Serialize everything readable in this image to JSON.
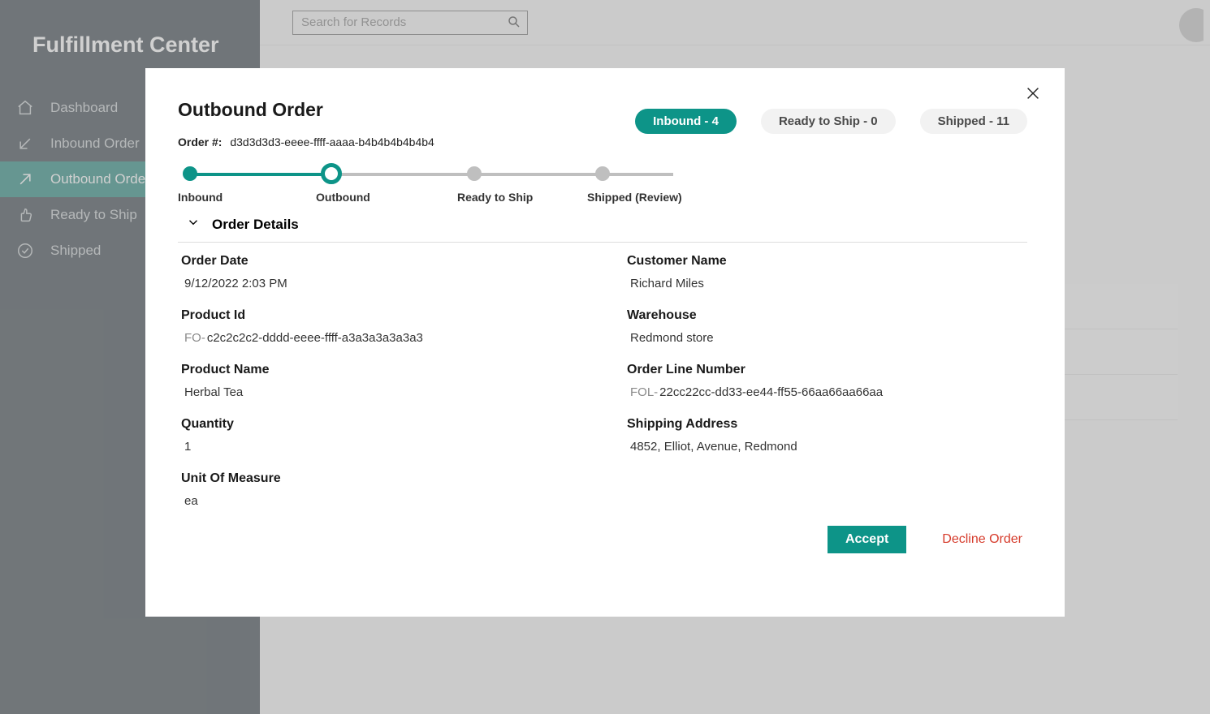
{
  "app_title": "Fulfillment Center",
  "search": {
    "placeholder": "Search for Records"
  },
  "sidebar": {
    "items": [
      {
        "label": "Dashboard",
        "active": false
      },
      {
        "label": "Inbound Order",
        "active": false
      },
      {
        "label": "Outbound Order",
        "active": true
      },
      {
        "label": "Ready to Ship",
        "active": false
      },
      {
        "label": "Shipped",
        "active": false
      }
    ]
  },
  "modal": {
    "title": "Outbound Order",
    "order_label": "Order #:",
    "order_id": "d3d3d3d3-eeee-ffff-aaaa-b4b4b4b4b4b4",
    "pills": [
      {
        "label": "Inbound - 4",
        "primary": true
      },
      {
        "label": "Ready to Ship - 0",
        "primary": false
      },
      {
        "label": "Shipped - 11",
        "primary": false
      }
    ],
    "steps": [
      {
        "label": "Inbound",
        "state": "done"
      },
      {
        "label": "Outbound",
        "state": "current"
      },
      {
        "label": "Ready to Ship",
        "state": "future"
      },
      {
        "label": "Shipped (Review)",
        "state": "future"
      }
    ],
    "section_title": "Order Details",
    "details": {
      "order_date_label": "Order Date",
      "order_date": "9/12/2022 2:03 PM",
      "product_id_label": "Product Id",
      "product_id_prefix": "FO-",
      "product_id": "c2c2c2c2-dddd-eeee-ffff-a3a3a3a3a3a3",
      "product_name_label": "Product Name",
      "product_name": "Herbal Tea",
      "quantity_label": "Quantity",
      "quantity": "1",
      "uom_label": "Unit Of Measure",
      "uom": "ea",
      "customer_name_label": "Customer Name",
      "customer_name": "Richard Miles",
      "warehouse_label": "Warehouse",
      "warehouse": "Redmond store",
      "oln_label": "Order Line Number",
      "oln_prefix": "FOL-",
      "oln": "22cc22cc-dd33-ee44-ff55-66aa66aa66aa",
      "shipping_label": "Shipping Address",
      "shipping": "4852, Elliot, Avenue, Redmond"
    },
    "actions": {
      "accept": "Accept",
      "decline": "Decline Order"
    }
  }
}
